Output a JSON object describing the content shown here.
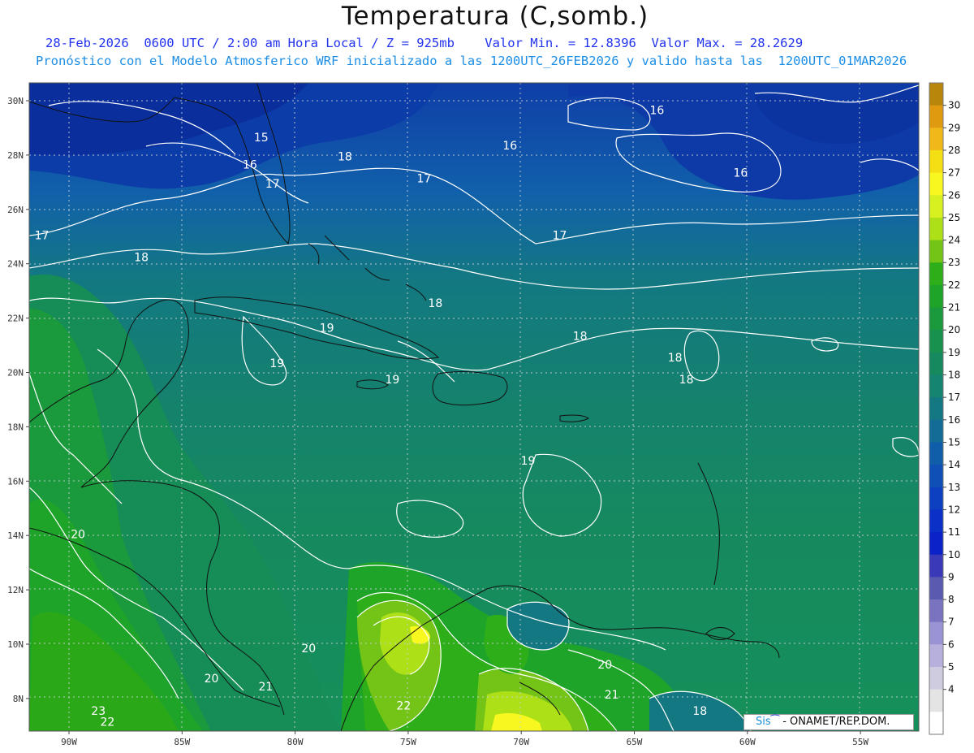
{
  "header": {
    "title": "Temperatura (C,somb.)",
    "line1": "28-Feb-2026  0600 UTC / 2:00 am Hora Local / Z = 925mb    Valor Min. = 12.8396  Valor Max. = 28.2629",
    "line2": "Pronóstico con el Modelo Atmosferico WRF inicializado a las 1200UTC_26FEB2026 y valido hasta las  1200UTC_01MAR2026"
  },
  "axes": {
    "lat_labels": [
      "30N",
      "28N",
      "26N",
      "24N",
      "22N",
      "20N",
      "18N",
      "16N",
      "14N",
      "12N",
      "10N",
      "8N"
    ],
    "lon_labels": [
      "90W",
      "85W",
      "80W",
      "75W",
      "70W",
      "65W",
      "60W",
      "55W"
    ]
  },
  "colorbar": {
    "ticks": [
      "30",
      "29",
      "28",
      "27",
      "26",
      "25",
      "24",
      "23",
      "22",
      "21",
      "20",
      "19",
      "18",
      "17",
      "16",
      "15",
      "14",
      "13",
      "12",
      "11",
      "10",
      "9",
      "8",
      "7",
      "6",
      "5",
      "4"
    ],
    "colors": [
      "#b8860b",
      "#e09a10",
      "#f0b818",
      "#f4de14",
      "#f8f820",
      "#d6f020",
      "#aee018",
      "#74c418",
      "#2eae18",
      "#1ea428",
      "#1a9a3c",
      "#18904e",
      "#168a5e",
      "#158470",
      "#137882",
      "#126c96",
      "#105eaa",
      "#0e50b6",
      "#0c40c0",
      "#0b30c8",
      "#0a22c8",
      "#3a3ab8",
      "#5a5ab0",
      "#7a74c0",
      "#9a94d4",
      "#b8b0dc",
      "#d0cce0",
      "#e4e4e4",
      "#ffffff"
    ]
  },
  "contour_labels": [
    {
      "text": "16",
      "lon": -70.5,
      "lat": 28.2
    },
    {
      "text": "16",
      "lon": -64.0,
      "lat": 29.5
    },
    {
      "text": "16",
      "lon": -60.3,
      "lat": 27.2
    },
    {
      "text": "15",
      "lon": -81.5,
      "lat": 28.5
    },
    {
      "text": "16",
      "lon": -82.0,
      "lat": 27.5
    },
    {
      "text": "17",
      "lon": -81.0,
      "lat": 26.8
    },
    {
      "text": "18",
      "lon": -77.8,
      "lat": 27.8
    },
    {
      "text": "17",
      "lon": -74.3,
      "lat": 27.0
    },
    {
      "text": "17",
      "lon": -91.2,
      "lat": 24.9
    },
    {
      "text": "18",
      "lon": -86.8,
      "lat": 24.1
    },
    {
      "text": "17",
      "lon": -68.3,
      "lat": 24.9
    },
    {
      "text": "18",
      "lon": -73.8,
      "lat": 22.4
    },
    {
      "text": "19",
      "lon": -78.6,
      "lat": 21.5
    },
    {
      "text": "18",
      "lon": -67.4,
      "lat": 21.2
    },
    {
      "text": "18",
      "lon": -63.2,
      "lat": 20.4
    },
    {
      "text": "18",
      "lon": -62.7,
      "lat": 19.6
    },
    {
      "text": "19",
      "lon": -80.8,
      "lat": 20.2
    },
    {
      "text": "19",
      "lon": -75.7,
      "lat": 19.6
    },
    {
      "text": "19",
      "lon": -69.7,
      "lat": 16.6
    },
    {
      "text": "20",
      "lon": -89.6,
      "lat": 13.9
    },
    {
      "text": "20",
      "lon": -79.4,
      "lat": 9.7
    },
    {
      "text": "20",
      "lon": -83.7,
      "lat": 8.6
    },
    {
      "text": "21",
      "lon": -81.3,
      "lat": 8.3
    },
    {
      "text": "20",
      "lon": -66.3,
      "lat": 9.1
    },
    {
      "text": "21",
      "lon": -66.0,
      "lat": 8.0
    },
    {
      "text": "22",
      "lon": -75.2,
      "lat": 7.6
    },
    {
      "text": "23",
      "lon": -88.7,
      "lat": 7.4
    },
    {
      "text": "22",
      "lon": -88.3,
      "lat": 7.0
    },
    {
      "text": "18",
      "lon": -62.1,
      "lat": 7.4
    }
  ],
  "credit": {
    "sis": "Sis",
    "wave": "⁀",
    "org": " - ONAMET/REP.DOM."
  }
}
